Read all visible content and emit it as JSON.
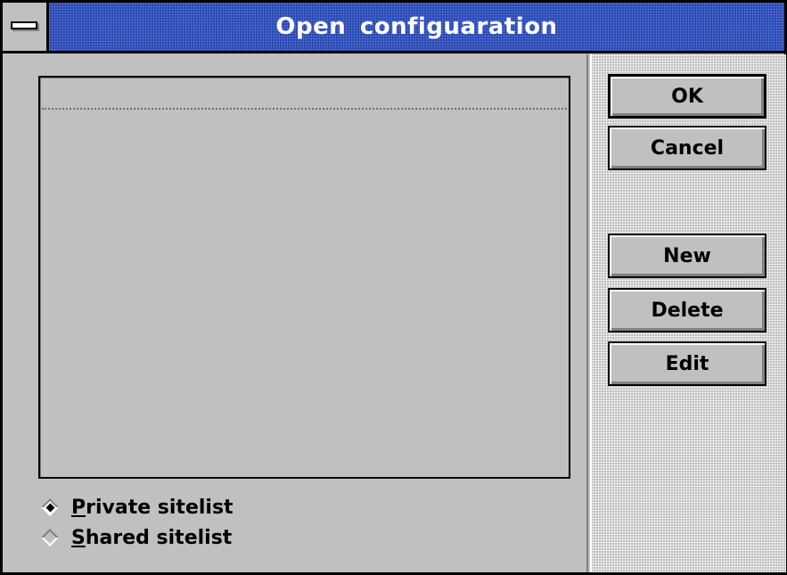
{
  "window": {
    "title": "Open configuaration"
  },
  "list": {
    "items": []
  },
  "radios": [
    {
      "prefix": "P",
      "rest": "rivate sitelist",
      "checked": true
    },
    {
      "prefix": "S",
      "rest": "hared sitelist",
      "checked": false
    }
  ],
  "buttons": {
    "ok": "OK",
    "cancel": "Cancel",
    "new": "New",
    "delete": "Delete",
    "edit": "Edit"
  },
  "icons": {
    "system_menu": "system-menu-icon",
    "radio": "radio-diamond-icon"
  },
  "colors": {
    "titlebar": "#1d3dab",
    "face": "#c0c0c0"
  }
}
